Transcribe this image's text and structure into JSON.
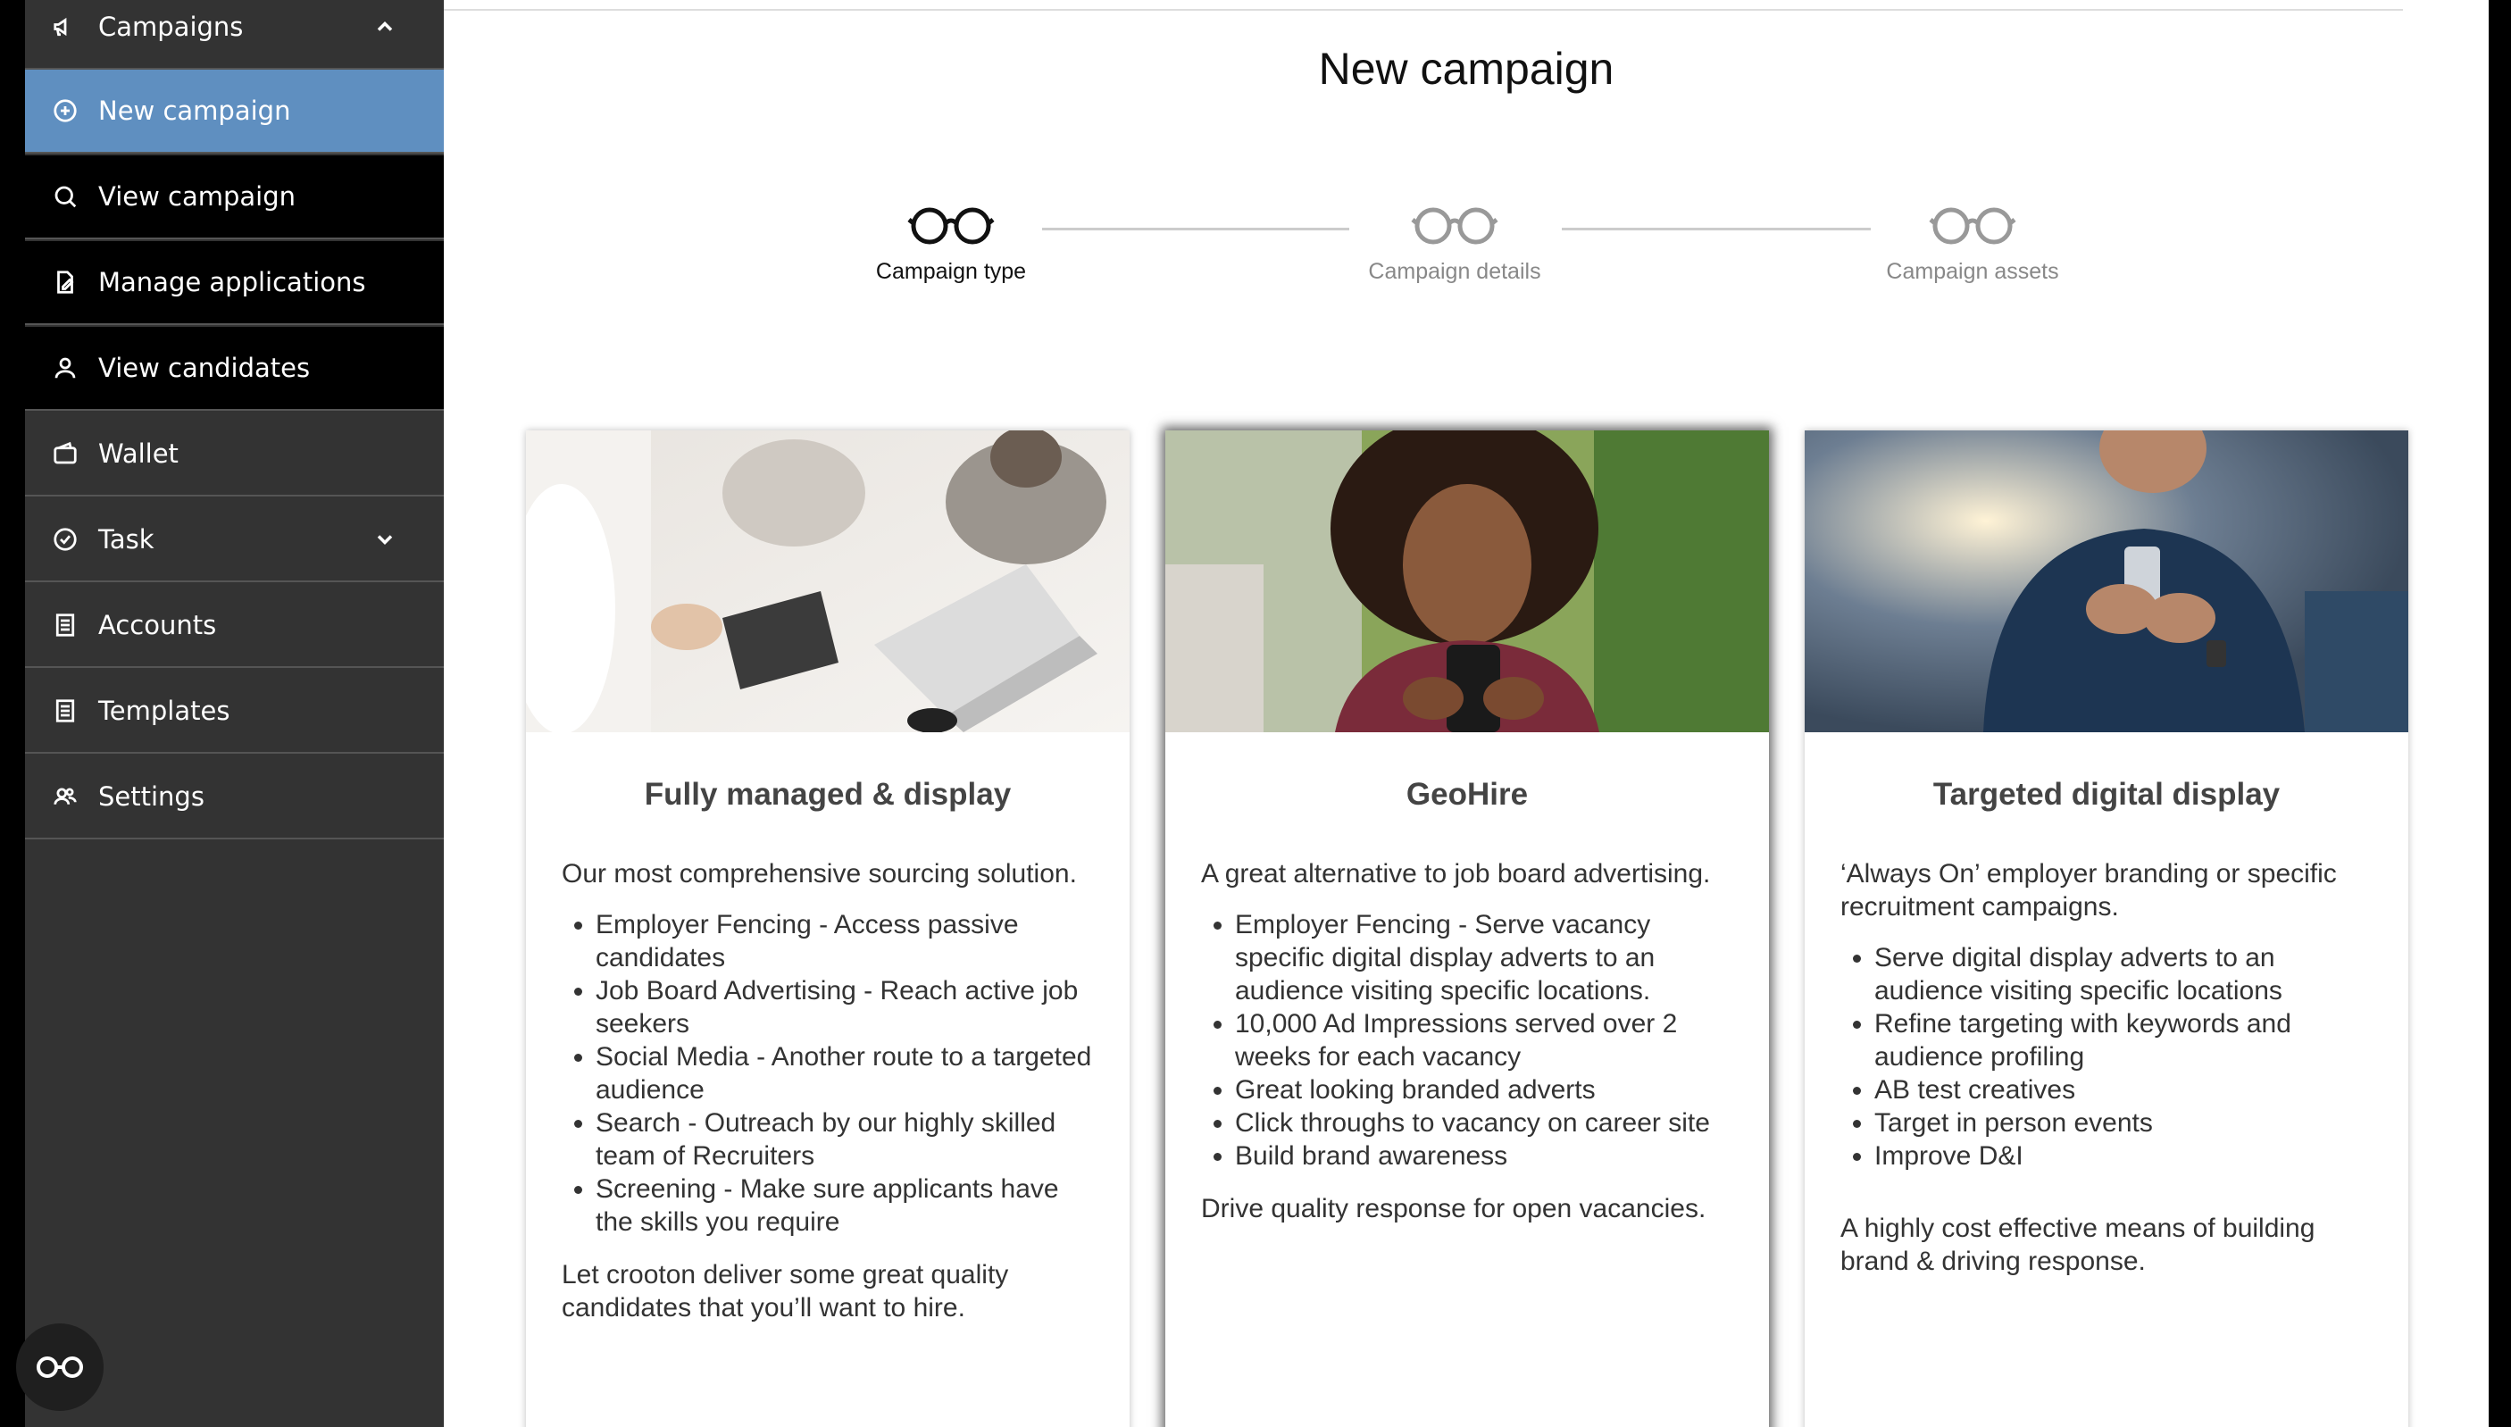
{
  "sidebar": {
    "items": [
      {
        "label": "Campaigns"
      },
      {
        "label": "New campaign"
      },
      {
        "label": "View campaign"
      },
      {
        "label": "Manage applications"
      },
      {
        "label": "View candidates"
      },
      {
        "label": "Wallet"
      },
      {
        "label": "Task"
      },
      {
        "label": "Accounts"
      },
      {
        "label": "Templates"
      },
      {
        "label": "Settings"
      }
    ]
  },
  "main": {
    "title": "New campaign",
    "steps": [
      {
        "label": "Campaign type"
      },
      {
        "label": "Campaign details"
      },
      {
        "label": "Campaign assets"
      }
    ],
    "cards": [
      {
        "title": "Fully managed & display",
        "intro": "Our most comprehensive sourcing solution.",
        "bullets": [
          "Employer Fencing - Access passive candidates",
          "Job Board Advertising - Reach active job seekers",
          "Social Media - Another route to a targeted audience",
          "Search - Outreach by our highly skilled team of Recruiters",
          "Screening - Make sure applicants have the skills you require"
        ],
        "footer": "Let crooton deliver some great quality candidates that you’ll want to hire."
      },
      {
        "title": "GeoHire",
        "intro": "A great alternative to job board advertising.",
        "bullets": [
          "Employer Fencing - Serve vacancy specific digital display adverts to an audience visiting specific locations.",
          "10,000 Ad Impressions served over 2 weeks for each vacancy",
          "Great looking branded adverts",
          "Click throughs to vacancy on career site",
          "Build brand awareness"
        ],
        "footer": "Drive quality response for open vacancies."
      },
      {
        "title": "Targeted digital display",
        "intro": "‘Always On’ employer branding or specific recruitment campaigns.",
        "bullets": [
          "Serve digital display adverts to an audience visiting specific locations",
          "Refine targeting with keywords and audience profiling",
          "AB test creatives",
          "Target in person events",
          "Improve D&I"
        ],
        "footer": "A highly cost effective means of building brand & driving response."
      }
    ]
  },
  "colors": {
    "active_nav": "#5f8fc0",
    "sidebar_bg": "#333333"
  }
}
